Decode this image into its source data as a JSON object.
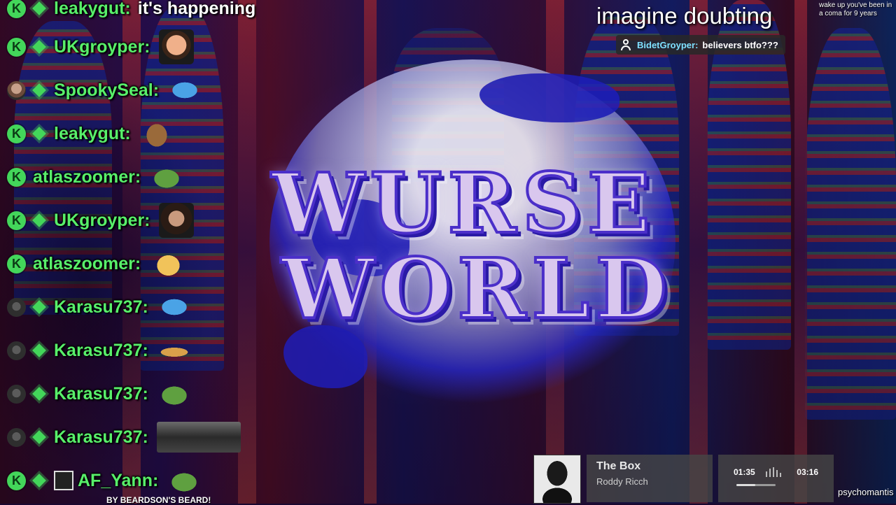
{
  "overlay": {
    "headline": "imagine doubting",
    "tiny_note": "wake up you've been in a coma for 9 years",
    "tts_alert": {
      "user": "BidetGroyper:",
      "message": "believers btfo???"
    },
    "logo_lines": [
      "WURSE",
      "WORLD"
    ],
    "bottom_caption": "BY BEARDSON'S BEARD!",
    "streamer_name": "psychomantis"
  },
  "chat": {
    "accent_color": "#58ef6a",
    "messages": [
      {
        "badge": "k",
        "user": "leakygut:",
        "text": "it's happening",
        "emote": ""
      },
      {
        "badge": "k",
        "user": "UKgroyper:",
        "text": "",
        "emote": "face"
      },
      {
        "badge": "avatar",
        "user": "SpookySeal:",
        "text": "",
        "emote": "fish"
      },
      {
        "badge": "k",
        "user": "leakygut:",
        "text": "",
        "emote": "dog"
      },
      {
        "badge": "k",
        "user": "atlaszoomer:",
        "text": "",
        "emote": "pepe"
      },
      {
        "badge": "k",
        "user": "UKgroyper:",
        "text": "",
        "emote": "man"
      },
      {
        "badge": "k",
        "user": "atlaszoomer:",
        "text": "",
        "emote": "blob"
      },
      {
        "badge": "avatar-dark",
        "user": "Karasu737:",
        "text": "",
        "emote": "fish"
      },
      {
        "badge": "avatar-dark",
        "user": "Karasu737:",
        "text": "",
        "emote": "lizard"
      },
      {
        "badge": "avatar-dark",
        "user": "Karasu737:",
        "text": "",
        "emote": "pepe"
      },
      {
        "badge": "avatar-dark",
        "user": "Karasu737:",
        "text": "",
        "emote": "car"
      },
      {
        "badge": "k",
        "user": "AF_Yann:",
        "text": "",
        "emote": "pepe"
      }
    ]
  },
  "music": {
    "title": "The Box",
    "artist": "Roddy Ricch",
    "current_time": "01:35",
    "total_time": "03:16",
    "progress_fraction": 0.48
  }
}
